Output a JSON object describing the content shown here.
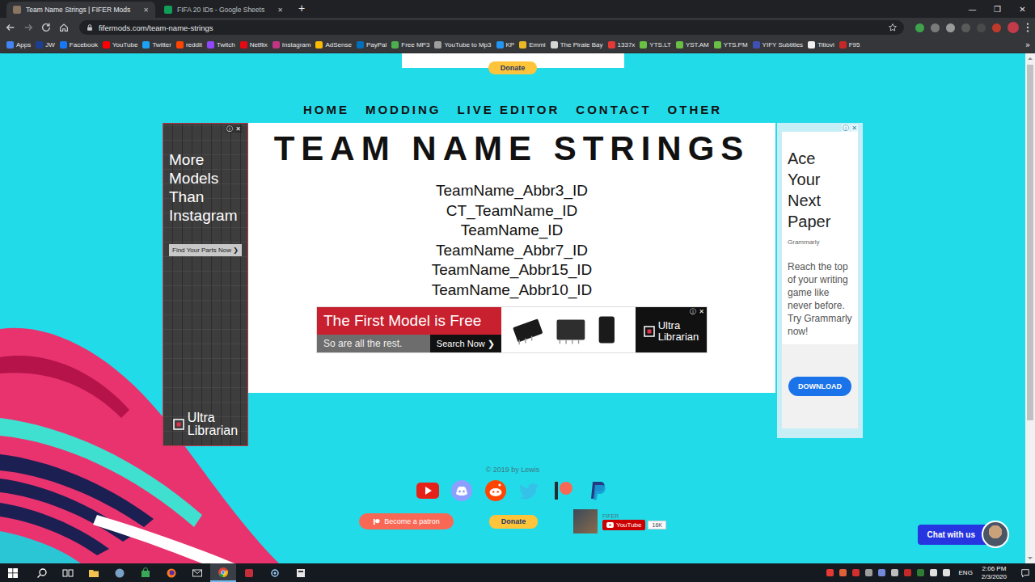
{
  "browser": {
    "tabs": [
      {
        "title": "Team Name Strings | FIFER Mods",
        "selected": true,
        "close": "✕",
        "color": "#8a7560"
      },
      {
        "title": "FIFA 20 IDs - Google Sheets",
        "selected": false,
        "close": "✕",
        "color": "#0f9d58"
      }
    ],
    "new_tab": "+",
    "window_controls": [
      "—",
      "❐",
      "✕"
    ],
    "url": "fifermods.com/team-name-strings",
    "bookmarks": [
      {
        "label": "Apps",
        "color": "#4285f4"
      },
      {
        "label": "JW",
        "color": "#1c3f94"
      },
      {
        "label": "Facebook",
        "color": "#1877f2"
      },
      {
        "label": "YouTube",
        "color": "#ff0000"
      },
      {
        "label": "Twitter",
        "color": "#1da1f2"
      },
      {
        "label": "reddit",
        "color": "#ff4500"
      },
      {
        "label": "Twitch",
        "color": "#9146ff"
      },
      {
        "label": "Netflix",
        "color": "#e50914"
      },
      {
        "label": "Instagram",
        "color": "#c13584"
      },
      {
        "label": "AdSense",
        "color": "#fbbc04"
      },
      {
        "label": "PayPal",
        "color": "#0070ba"
      },
      {
        "label": "Free MP3",
        "color": "#4caf50"
      },
      {
        "label": "YouTube to Mp3",
        "color": "#9e9e9e"
      },
      {
        "label": "KP",
        "color": "#2196f3"
      },
      {
        "label": "Emmi",
        "color": "#e8b923"
      },
      {
        "label": "The Pirate Bay",
        "color": "#d6d6d6"
      },
      {
        "label": "1337x",
        "color": "#e53935"
      },
      {
        "label": "YTS.LT",
        "color": "#6ac045"
      },
      {
        "label": "YST.AM",
        "color": "#6ac045"
      },
      {
        "label": "YTS.PM",
        "color": "#6ac045"
      },
      {
        "label": "YIFY Subtitles",
        "color": "#3f51b5"
      },
      {
        "label": "Titlovi",
        "color": "#f0f0f0"
      },
      {
        "label": "F95",
        "color": "#c62828"
      }
    ],
    "bookmarks_more": "»"
  },
  "page": {
    "top_donate": "Donate",
    "nav": [
      "HOME",
      "MODDING",
      "LIVE EDITOR",
      "CONTACT",
      "OTHER"
    ],
    "title": "TEAM NAME STRINGS",
    "strings": [
      "TeamName_Abbr3_ID",
      "CT_TeamName_ID",
      "TeamName_ID",
      "TeamName_Abbr7_ID",
      "TeamName_Abbr15_ID",
      "TeamName_Abbr10_ID"
    ],
    "ad_marks": [
      "ⓘ",
      "✕"
    ],
    "left_ad": {
      "headline": "More Models Than Instagram",
      "button": "Find Your Parts Now ❯",
      "brand": [
        "Ultra",
        "Librarian"
      ]
    },
    "banner_ad": {
      "headline": "The First Model is Free",
      "subline": "So are all the rest.",
      "button": "Search Now ❯",
      "brand": [
        "Ultra",
        "Librarian"
      ]
    },
    "right_ad": {
      "headline": "Ace Your Next Paper",
      "advertiser": "Grammarly",
      "body": "Reach the top of your writing game like never before. Try Grammarly now!",
      "button": "DOWNLOAD"
    },
    "footer": {
      "copyright": "© 2019 by Lewis",
      "patron": "Become a patron",
      "donate": "Donate",
      "channel": "FIFER",
      "youtube": "YouTube",
      "subscribers": "16K"
    },
    "chat": "Chat with us"
  },
  "taskbar": {
    "language": "ENG",
    "time": "2:06 PM",
    "date": "2/3/2020"
  }
}
